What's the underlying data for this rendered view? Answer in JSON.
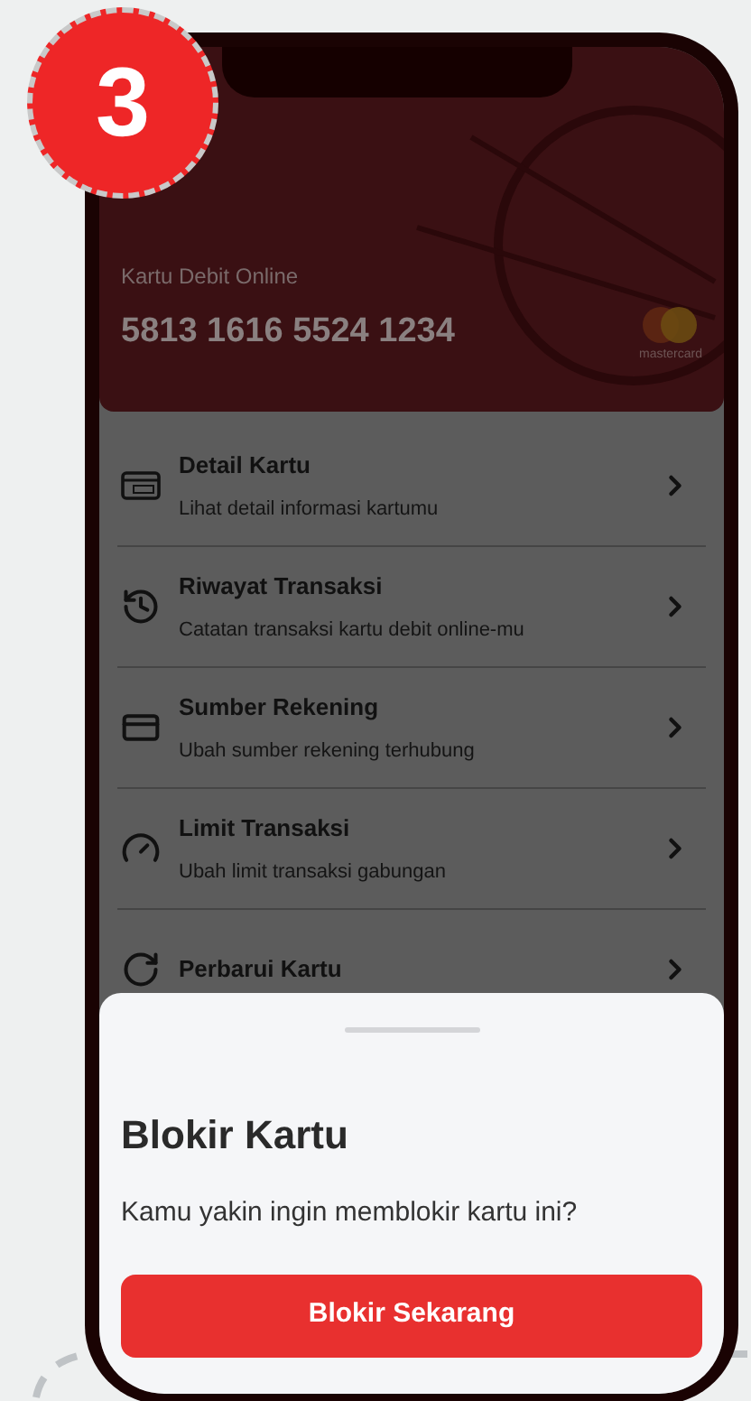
{
  "step_badge": "3",
  "card": {
    "label": "Kartu Debit Online",
    "number": "5813 1616 5524 1234",
    "brand": "mastercard"
  },
  "menu": [
    {
      "title": "Detail Kartu",
      "subtitle": "Lihat detail informasi kartumu"
    },
    {
      "title": "Riwayat Transaksi",
      "subtitle": "Catatan transaksi kartu debit online-mu"
    },
    {
      "title": "Sumber Rekening",
      "subtitle": "Ubah sumber rekening terhubung"
    },
    {
      "title": "Limit Transaksi",
      "subtitle": "Ubah limit transaksi gabungan"
    },
    {
      "title": "Perbarui Kartu"
    }
  ],
  "sheet": {
    "title": "Blokir Kartu",
    "message": "Kamu yakin ingin memblokir kartu ini?",
    "button": "Blokir Sekarang"
  }
}
